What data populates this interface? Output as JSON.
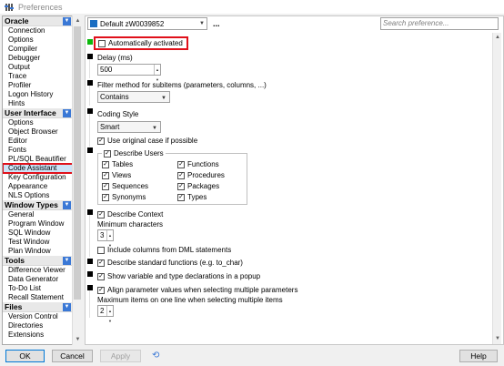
{
  "window": {
    "title": "Preferences"
  },
  "sidebar": {
    "groups": [
      {
        "label": "Oracle",
        "items": [
          "Connection",
          "Options",
          "Compiler",
          "Debugger",
          "Output",
          "Trace",
          "Profiler",
          "Logon History",
          "Hints"
        ]
      },
      {
        "label": "User Interface",
        "items": [
          "Options",
          "Object Browser",
          "Editor",
          "Fonts",
          "PL/SQL Beautifier",
          "Code Assistant",
          "Key Configuration",
          "Appearance",
          "NLS Options"
        ]
      },
      {
        "label": "Window Types",
        "items": [
          "General",
          "Program Window",
          "SQL Window",
          "Test Window",
          "Plan Window"
        ]
      },
      {
        "label": "Tools",
        "items": [
          "Difference Viewer",
          "Data Generator",
          "To-Do List",
          "Recall Statement"
        ]
      },
      {
        "label": "Files",
        "items": [
          "Version Control",
          "Directories",
          "Extensions"
        ]
      }
    ],
    "selected": "Code Assistant"
  },
  "topbar": {
    "profile": "Default zW0039852",
    "ellipsis": "...",
    "search_placeholder": "Search preference..."
  },
  "settings": {
    "auto_activated": {
      "label": "Automatically activated",
      "checked": false
    },
    "delay": {
      "label": "Delay (ms)",
      "value": "500"
    },
    "filter_method": {
      "label": "Filter method for subitems (parameters, columns, ...)",
      "value": "Contains"
    },
    "coding_style": {
      "label": "Coding Style",
      "value": "Smart"
    },
    "original_case": {
      "label": "Use original case if possible",
      "checked": true
    },
    "describe_users": {
      "label": "Describe Users",
      "checked": true,
      "left": [
        {
          "label": "Tables",
          "checked": true
        },
        {
          "label": "Views",
          "checked": true
        },
        {
          "label": "Sequences",
          "checked": true
        },
        {
          "label": "Synonyms",
          "checked": true
        }
      ],
      "right": [
        {
          "label": "Functions",
          "checked": true
        },
        {
          "label": "Procedures",
          "checked": true
        },
        {
          "label": "Packages",
          "checked": true
        },
        {
          "label": "Types",
          "checked": true
        }
      ]
    },
    "describe_context": {
      "label": "Describe Context",
      "checked": true
    },
    "min_chars": {
      "label": "Minimum characters",
      "value": "3"
    },
    "dml_columns": {
      "label": "Include columns from DML statements",
      "checked": false
    },
    "describe_std_functions": {
      "label": "Describe standard functions (e.g. to_char)",
      "checked": true
    },
    "show_vars": {
      "label": "Show variable and type declarations in a popup",
      "checked": true
    },
    "align_params": {
      "label": "Align parameter values when selecting multiple parameters",
      "checked": true
    },
    "max_items": {
      "label": "Maximum items on one line when selecting multiple items",
      "value": "2"
    }
  },
  "buttons": {
    "ok": "OK",
    "cancel": "Cancel",
    "apply": "Apply",
    "help": "Help"
  },
  "colors": {
    "highlight": "#e0101a",
    "accent": "#3a78d6",
    "selected_bg": "#cde3f7",
    "active_marker": "#0bb80b"
  }
}
